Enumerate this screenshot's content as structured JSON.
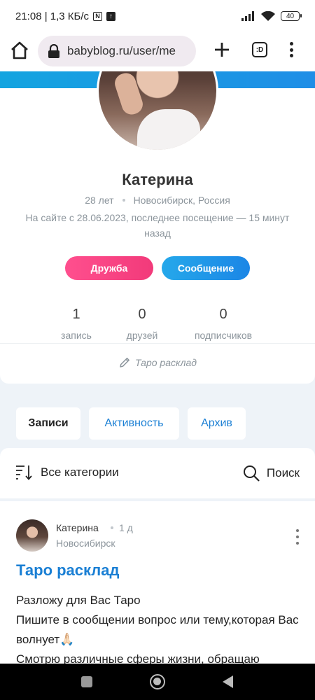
{
  "status_bar": {
    "time_speed": "21:08 | 1,3 КБ/с",
    "nfc_icon_text": "N",
    "upload_icon_text": "↑",
    "battery": "40"
  },
  "browser": {
    "url": "babyblog.ru/user/me",
    "tabs_label": ":D"
  },
  "profile": {
    "name": "Катерина",
    "age": "28 лет",
    "location": "Новосибирск, Россия",
    "since": "На сайте с 28.06.2023, последнее посещение — 15 минут назад",
    "friend_button": "Дружба",
    "message_button": "Сообщение",
    "stats": [
      {
        "value": "1",
        "label": "запись"
      },
      {
        "value": "0",
        "label": "друзей"
      },
      {
        "value": "0",
        "label": "подписчиков"
      }
    ],
    "status_link": "Таро расклад"
  },
  "tabs": [
    {
      "label": "Записи"
    },
    {
      "label": "Активность"
    },
    {
      "label": "Архив"
    }
  ],
  "filter": {
    "categories": "Все категории",
    "search": "Поиск"
  },
  "post": {
    "author": "Катерина",
    "time": "1 д",
    "city": "Новосибирск",
    "title": "Таро расклад",
    "body_line1": "Разложу для Вас Таро",
    "body_line2": "Пишите в сообщении вопрос или тему,которая Вас волнует🙏🏻",
    "body_line3": "Смотрю различные сферы жизни, обращаю"
  },
  "colors": {
    "accent_blue": "#1a7fd4",
    "friend_pink": "#f23a7a",
    "message_blue": "#1b86e6"
  },
  "icons": [
    "home-icon",
    "lock-icon",
    "plus-icon",
    "tabs-icon",
    "more-vert-icon",
    "pencil-icon",
    "sort-icon",
    "search-icon",
    "recents-icon",
    "nav-home-icon",
    "back-icon"
  ]
}
